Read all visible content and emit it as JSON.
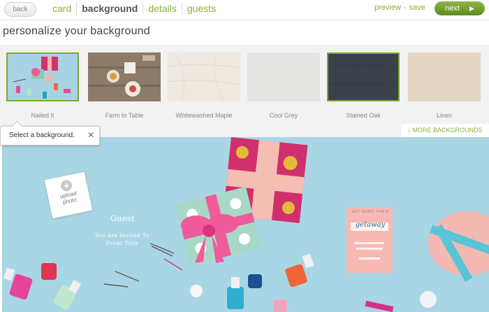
{
  "topbar": {
    "back_label": "back",
    "steps": [
      "card",
      "background",
      "details",
      "guests"
    ],
    "active_step": "background",
    "preview_label": "preview",
    "separator": "-",
    "save_label": "save",
    "next_label": "next"
  },
  "page": {
    "title": "personalize your background"
  },
  "backgrounds": {
    "items": [
      {
        "label": "Nailed It",
        "selected": true
      },
      {
        "label": "Farm to Table",
        "selected": false
      },
      {
        "label": "Whitewashed Maple",
        "selected": false
      },
      {
        "label": "Cool Grey",
        "selected": false
      },
      {
        "label": "Stained Oak",
        "selected": true
      },
      {
        "label": "Linen",
        "selected": false
      }
    ],
    "more_label": "↓  MORE BACKGROUNDS"
  },
  "tooltip": {
    "text": "Select a background.",
    "close": "✕"
  },
  "preview": {
    "upload_label_line1": "upload",
    "upload_label_line2": "photo",
    "guest_name": "Guest",
    "invite_line1": "You Are Invited To",
    "invite_line2": "Event Title",
    "card_script": "getaway",
    "card_top": "GET READY FOR A"
  },
  "colors": {
    "accent": "#8cae3c",
    "next_button": "#6f9a2a",
    "preview_bg": "#a9d6e4"
  }
}
